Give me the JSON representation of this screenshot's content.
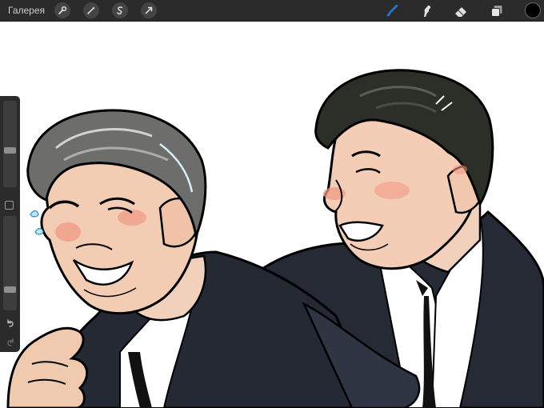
{
  "toolbar": {
    "gallery_label": "Галерея",
    "left_tools": [
      "wrench-icon",
      "magic-wand-icon",
      "selection-icon",
      "transform-icon"
    ],
    "right_tools": [
      "brush-icon",
      "smudge-icon",
      "eraser-icon",
      "layers-icon"
    ],
    "active_tool": "brush-icon",
    "current_color": "#000000",
    "accent_color": "#1f7ae0"
  },
  "sidebar": {
    "brush_size_level": 0.42,
    "opacity_level": 0.2,
    "controls": [
      "modify-button",
      "undo-button",
      "redo-button"
    ]
  },
  "canvas": {
    "content": "illustration"
  }
}
